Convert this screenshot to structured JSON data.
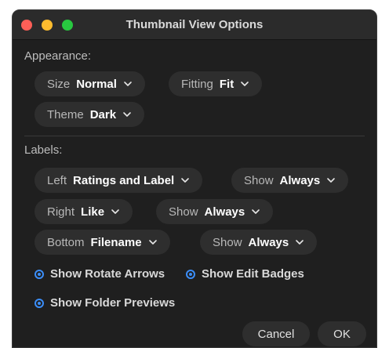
{
  "window": {
    "title": "Thumbnail View Options"
  },
  "appearance": {
    "section_label": "Appearance:",
    "size": {
      "label": "Size",
      "value": "Normal"
    },
    "fitting": {
      "label": "Fitting",
      "value": "Fit"
    },
    "theme": {
      "label": "Theme",
      "value": "Dark"
    }
  },
  "labels": {
    "section_label": "Labels:",
    "left": {
      "label": "Left",
      "value": "Ratings and Label"
    },
    "left_show": {
      "label": "Show",
      "value": "Always"
    },
    "right": {
      "label": "Right",
      "value": "Like"
    },
    "right_show": {
      "label": "Show",
      "value": "Always"
    },
    "bottom": {
      "label": "Bottom",
      "value": "Filename"
    },
    "bottom_show": {
      "label": "Show",
      "value": "Always"
    }
  },
  "options": {
    "show_rotate_arrows": "Show Rotate Arrows",
    "show_edit_badges": "Show Edit Badges",
    "show_folder_previews": "Show Folder Previews"
  },
  "buttons": {
    "cancel": "Cancel",
    "ok": "OK"
  },
  "colors": {
    "accent": "#3b8df7",
    "window_bg": "#1f1f1f",
    "pill_bg": "#2e2e2e"
  },
  "icons": {
    "chevron": "chevron-down-icon",
    "radio": "radio-selected-icon"
  }
}
